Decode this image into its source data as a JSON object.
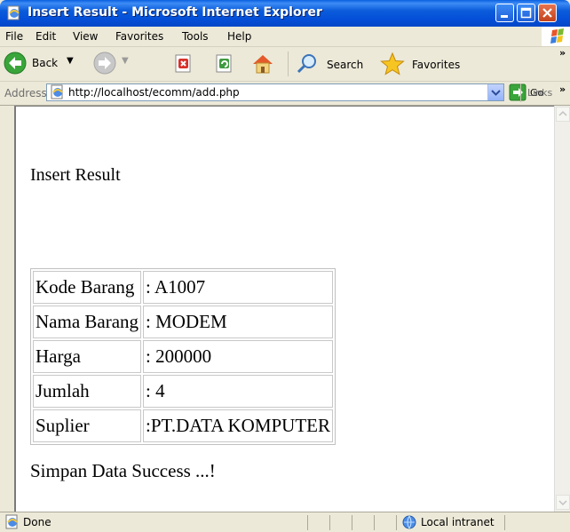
{
  "window": {
    "title": "Insert Result - Microsoft Internet Explorer"
  },
  "menu": {
    "items": [
      "File",
      "Edit",
      "View",
      "Favorites",
      "Tools",
      "Help"
    ]
  },
  "toolbar": {
    "back_label": "Back",
    "search_label": "Search",
    "favorites_label": "Favorites"
  },
  "address_bar": {
    "label": "Address",
    "url": "http://localhost/ecomm/add.php",
    "go_label": "Go",
    "links_label": "Links"
  },
  "page": {
    "heading": "Insert Result",
    "rows": [
      {
        "label": "Kode Barang",
        "value": ": A1007"
      },
      {
        "label": "Nama Barang",
        "value": ": MODEM"
      },
      {
        "label": "Harga",
        "value": ": 200000"
      },
      {
        "label": "Jumlah",
        "value": ": 4"
      },
      {
        "label": "Suplier",
        "value": ":PT.DATA KOMPUTER"
      }
    ],
    "message": "Simpan Data Success ...!"
  },
  "status": {
    "text": "Done",
    "zone": "Local intranet"
  },
  "colors": {
    "titlebar": "#0550D8",
    "chrome": "#ECE9D8",
    "go_arrow": "#3AA53A",
    "stop_icon": "#D9312B"
  }
}
